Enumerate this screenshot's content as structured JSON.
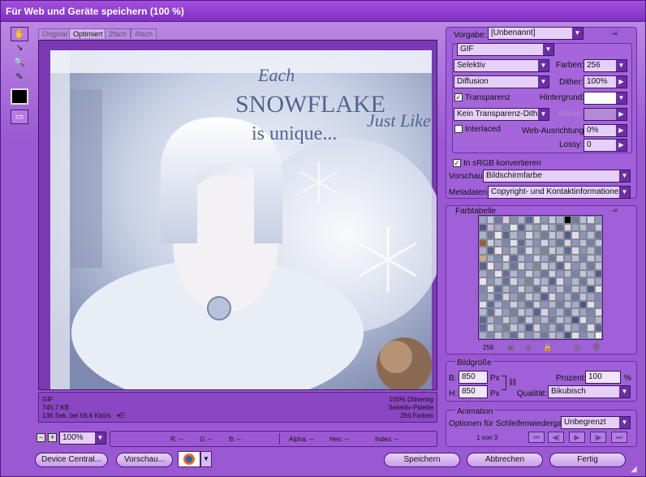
{
  "window": {
    "title": "Für Web und Geräte speichern (100 %)"
  },
  "tabs": [
    {
      "label": "Original"
    },
    {
      "label": "Optimiert"
    },
    {
      "label": "2fach"
    },
    {
      "label": "4fach"
    }
  ],
  "image": {
    "text_each": "Each",
    "text_snowflake": "SNOWFLAKE",
    "text_unique": "is unique...",
    "text_justlike": "Just Like Y"
  },
  "info_left": {
    "format": "GIF",
    "size": "745,7 KB",
    "time": "136 Sek. bei 56,6 Kbit/s"
  },
  "info_right": {
    "dither": "100% Dithering",
    "palette": "Selektiv-Palette",
    "colors": "256 Farben"
  },
  "zoom": {
    "value": "100%"
  },
  "readout": {
    "r": "R: --",
    "g": "G: --",
    "b": "B: --",
    "alpha": "Alpha: --",
    "hex": "Hex: --",
    "index": "Index: --"
  },
  "settings": {
    "preset_label": "Vorgabe:",
    "preset_value": "[Unbenannt]",
    "format_value": "GIF",
    "reduction_value": "Selektiv",
    "colors_label": "Farben:",
    "colors_value": "256",
    "dither_algo_value": "Diffusion",
    "dither_label": "Dither:",
    "dither_value": "100%",
    "transparency_label": "Transparenz",
    "matte_label": "Hintergrund:",
    "transparency_dither_value": "Kein Transparenz-Dither",
    "amount_label": "Stärke:",
    "interlaced_label": "Interlaced",
    "websnap_label": "Web-Ausrichtung:",
    "websnap_value": "0%",
    "lossy_label": "Lossy:",
    "lossy_value": "0",
    "srgb_label": "In sRGB konvertieren",
    "preview_label": "Vorschau:",
    "preview_value": "Bildschirmfarbe",
    "metadata_label": "Metadaten:",
    "metadata_value": "Copyright- und Kontaktinformationen"
  },
  "color_table": {
    "title": "Farbtabelle",
    "count": "256",
    "swatches": [
      "#9aa3c8",
      "#bfc7e0",
      "#6b79a8",
      "#d9c6e6",
      "#7d8bb8",
      "#aab4d6",
      "#5c6b9a",
      "#e1d8ef",
      "#8994bf",
      "#c6cce4",
      "#a7aecf",
      "#000000",
      "#6f7aa5",
      "#b9c0dc",
      "#d1d6ea",
      "#8c96c0",
      "#4d5a8c",
      "#c8b6df",
      "#9fa8cc",
      "#7985b2",
      "#e5e1f1",
      "#566492",
      "#b2b9d8",
      "#8d97c1",
      "#cdd2e8",
      "#a3abcd",
      "#62709f",
      "#dcd2ec",
      "#93a5c9",
      "#b8bdd9",
      "#7b88b5",
      "#c4c9e2",
      "#a3b8c4",
      "#6f7b9b",
      "#e9e4f3",
      "#5a6894",
      "#b0b7d6",
      "#8592bd",
      "#d4d9eb",
      "#9ca5ca",
      "#71809f",
      "#c2c8e1",
      "#acb3d4",
      "#4f5c8e",
      "#dfd9ee",
      "#8a93bc",
      "#b6bdd9",
      "#6874a2",
      "#93613f",
      "#c7cde4",
      "#a8b0d1",
      "#7a87b4",
      "#e2ddef",
      "#5e6c99",
      "#b4bbd8",
      "#898fb9",
      "#cfd4e9",
      "#a0a9cc",
      "#687699",
      "#d8d3ea",
      "#9099c3",
      "#bcc1dc",
      "#7581ae",
      "#c1c7e0",
      "#a6aecf",
      "#52608f",
      "#e6e2f2",
      "#8e98c1",
      "#b7bdd9",
      "#6a77a4",
      "#d2d7ea",
      "#9aa3c8",
      "#79869f",
      "#c5cbe3",
      "#aeb5d5",
      "#5b6997",
      "#dbd5ec",
      "#8791bd",
      "#b3bad7",
      "#6d7aa6",
      "#c9a88e",
      "#a4acce",
      "#7e8bb7",
      "#e3dff0",
      "#606e9a",
      "#b1b8d7",
      "#8690bb",
      "#ced3e8",
      "#9ea7cb",
      "#6c7aa0",
      "#d6d1e9",
      "#939cc4",
      "#bac0db",
      "#7784b0",
      "#c3c8e1",
      "#a9b1d2",
      "#55638f",
      "#e8e3f3",
      "#8b95bf",
      "#b5bcd8",
      "#6776a3",
      "#d0d5e9",
      "#98a1c7",
      "#7b879d",
      "#c7cce4",
      "#acb3d4",
      "#59679a",
      "#ddd7ed",
      "#8892bd",
      "#b2b9d7",
      "#6f7ca7",
      "#c0c6e0",
      "#a2aacd",
      "#8088b6",
      "#e4e0f1",
      "#626f9b",
      "#afb6d6",
      "#848ebb",
      "#ccd1e7",
      "#9ca5ca",
      "#6a789e",
      "#d4cfe8",
      "#919ac3",
      "#b8bedb",
      "#7582af",
      "#c1c7e1",
      "#a7afd0",
      "#4e5c8d",
      "#e7e2f2",
      "#8993be",
      "#b3bad8",
      "#6574a2",
      "#cfd4e8",
      "#96a0c6",
      "#79879c",
      "#c5cae3",
      "#aab1d3",
      "#57659a",
      "#dad4ec",
      "#8690bc",
      "#b0b7d6",
      "#6d7aa7",
      "#bec4df",
      "#a0a8cc",
      "#7d89b5",
      "#e2def0",
      "#5f6d9a",
      "#adb4d5",
      "#828cba",
      "#cacfe6",
      "#9aa3c9",
      "#68769d",
      "#d2cde7",
      "#8f98c2",
      "#b6bcda",
      "#7380ae",
      "#bfc5e0",
      "#a5add0",
      "#4c5a8c",
      "#e5e0f1",
      "#8791bd",
      "#b1b8d7",
      "#6372a1",
      "#cdd2e7",
      "#949ec5",
      "#77859b",
      "#c3c8e2",
      "#a8afd2",
      "#556399",
      "#d8d2eb",
      "#848ebb",
      "#aeb5d5",
      "#6b78a6",
      "#bcc2de",
      "#9ea6cb",
      "#7b87b4",
      "#e0dcef",
      "#5d6b99",
      "#abb2d4",
      "#808ab9",
      "#c8cde5",
      "#98a1c8",
      "#66749c",
      "#d0cbe6",
      "#8d96c1",
      "#b4bad9",
      "#717ead",
      "#bdc3df",
      "#a3abcf",
      "#4a588b",
      "#e3def0",
      "#858fbc",
      "#afb6d6",
      "#6170a0",
      "#cbd0e6",
      "#929cc4",
      "#75839a",
      "#c1c6e1",
      "#a6add1",
      "#536198",
      "#d6d0ea",
      "#828cba",
      "#acb3d4",
      "#6976a5",
      "#bac0dd",
      "#9ca4ca",
      "#7985b3",
      "#dedaee",
      "#5b6998",
      "#a9b0d3",
      "#7e88b8",
      "#c6cbe4",
      "#969fc7",
      "#64729b",
      "#cec9e5",
      "#8b94c0",
      "#b2b8d8",
      "#6f7cac",
      "#bbc1de",
      "#a1a9ce",
      "#485689",
      "#e1dcef",
      "#838dbb",
      "#adb4d5",
      "#5f6e9f",
      "#c9cee5",
      "#909ac3",
      "#738199",
      "#bfc4e0",
      "#a4abd0",
      "#515f97",
      "#d4cee9",
      "#808ab9",
      "#aab1d3",
      "#6774a4",
      "#b8bedc",
      "#9aa2c9",
      "#7783b2",
      "#dcd8ed",
      "#59679a",
      "#a7aed2",
      "#7c86b7",
      "#c4c9e3",
      "#949dc6",
      "#62709a",
      "#ccc7e4",
      "#8992bf",
      "#b0b6d7",
      "#6d7aab",
      "#b9bfdd",
      "#9fa7cd",
      "#465488",
      "#dfdaee",
      "#818bba",
      "#abb2d4",
      "#f2f2f2"
    ]
  },
  "image_size": {
    "title": "Bildgröße",
    "width_label": "B:",
    "width_value": "850",
    "height_label": "H:",
    "height_value": "850",
    "unit": "Px",
    "percent_label": "Prozent:",
    "percent_value": "100",
    "percent_unit": "%",
    "quality_label": "Qualität:",
    "quality_value": "Bikubisch"
  },
  "animation": {
    "title": "Animation",
    "loop_label": "Optionen für Schleifenwiedergabe:",
    "loop_value": "Unbegrenzt",
    "frame_counter": "1 von 3"
  },
  "footer": {
    "device_central": "Device Central...",
    "preview": "Vorschau...",
    "save": "Speichern",
    "cancel": "Abbrechen",
    "done": "Fertig"
  },
  "colors": {
    "accent": "#9a58d2",
    "titlebar": "#7f2fc0"
  }
}
